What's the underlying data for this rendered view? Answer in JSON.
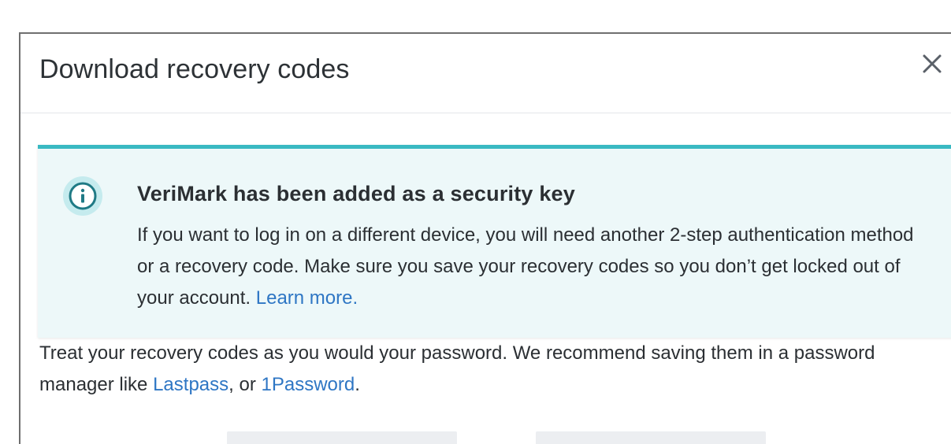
{
  "modal": {
    "title": "Download recovery codes",
    "close_icon": "close-icon"
  },
  "alert": {
    "icon": "info-icon",
    "accent_color": "#39b9c2",
    "background_color": "#edf8f9",
    "title": "VeriMark has been added as a security key",
    "body": "If you want to log in on a different device, you will need another 2-step authentication method or a recovery code. Make sure you save your recovery codes so you don’t get locked out of your account. ",
    "learn_more": "Learn more."
  },
  "intro": {
    "text_before": "Treat your recovery codes as you would your password. We recommend saving them in a password manager like ",
    "link_lastpass": "Lastpass",
    "separator": ", or ",
    "link_1password": "1Password",
    "text_after": "."
  },
  "colors": {
    "link": "#2e76c4",
    "text": "#2b2f33"
  }
}
